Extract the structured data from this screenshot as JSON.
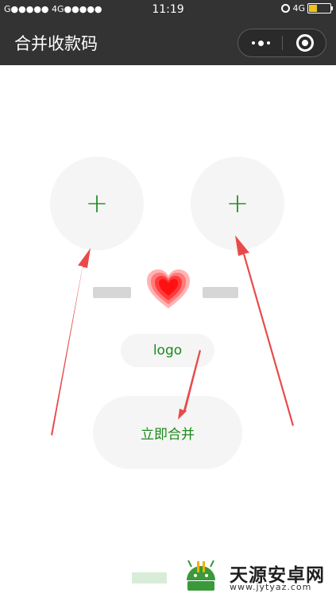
{
  "status_bar": {
    "left": "G●●●●● 4G●●●●●",
    "time": "11:19",
    "net": "4G",
    "battery_level": 0.4
  },
  "nav": {
    "title": "合并收款码",
    "more_icon": "more-dots-icon",
    "close_icon": "target-icon"
  },
  "content": {
    "upload_left_symbol": "+",
    "upload_right_symbol": "+",
    "heart_icon": "heart-icon",
    "logo_label": "logo",
    "merge_button": "立即合并"
  },
  "watermark": {
    "name": "天源安卓网",
    "url": "www.jytyaz.com"
  },
  "colors": {
    "bar_bg": "#333333",
    "accent_green": "#1a8a1a",
    "circle_bg": "#f5f5f5",
    "heart_red": "#ff1a1a",
    "arrow_red": "#e84a4a"
  }
}
